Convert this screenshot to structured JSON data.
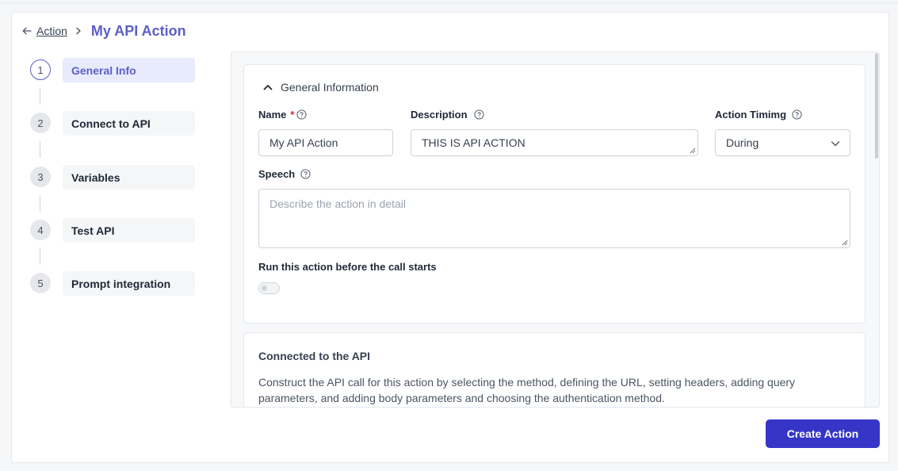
{
  "breadcrumb": {
    "back_label": "Action",
    "title": "My API Action"
  },
  "steps": [
    {
      "num": "1",
      "label": "General Info",
      "active": true
    },
    {
      "num": "2",
      "label": "Connect to API",
      "active": false
    },
    {
      "num": "3",
      "label": "Variables",
      "active": false
    },
    {
      "num": "4",
      "label": "Test API",
      "active": false
    },
    {
      "num": "5",
      "label": "Prompt integration",
      "active": false
    }
  ],
  "general": {
    "section_title": "General Information",
    "name_label": "Name",
    "required_mark": "*",
    "name_value": "My API Action",
    "description_label": "Description",
    "description_value": "THIS IS API ACTION",
    "timing_label": "Action Timimg",
    "timing_value": "During",
    "speech_label": "Speech",
    "speech_placeholder": "Describe the action in detail",
    "toggle_label": "Run this action before the call starts",
    "toggle_on": false
  },
  "api": {
    "title": "Connected to the API",
    "description": "Construct the API call for this action by selecting the method, defining the URL, setting headers, adding query parameters, and adding body parameters and choosing the authentication method."
  },
  "footer": {
    "create_label": "Create Action"
  },
  "colors": {
    "accent": "#5b5fc7",
    "button": "#3535c8",
    "required": "#dc2626"
  }
}
